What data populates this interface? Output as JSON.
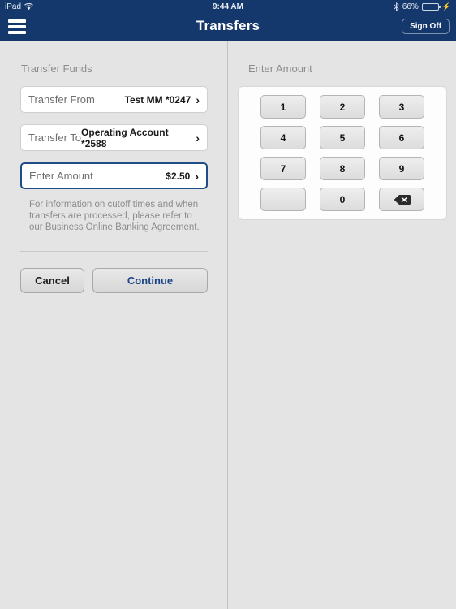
{
  "status_bar": {
    "device": "iPad",
    "wifi_icon": "wifi-icon",
    "time": "9:44 AM",
    "bluetooth_icon": "bluetooth-icon",
    "battery_percent": "66%",
    "battery_level": 66,
    "charging_icon": "lightning-bolt-icon"
  },
  "nav_bar": {
    "menu_icon": "hamburger-menu-icon",
    "title": "Transfers",
    "sign_off_label": "Sign Off"
  },
  "left_pane": {
    "section_title": "Transfer Funds",
    "rows": [
      {
        "label": "Transfer From",
        "value": "Test MM *0247",
        "chevron": "›",
        "focused": false
      },
      {
        "label": "Transfer To",
        "value": "Operating Account *2588",
        "chevron": "›",
        "focused": false
      },
      {
        "label": "Enter Amount",
        "value": "$2.50",
        "chevron": "›",
        "focused": true
      }
    ],
    "note": "For information on cutoff times and when transfers are processed, please refer to our Business Online Banking Agreement.",
    "cancel_label": "Cancel",
    "continue_label": "Continue"
  },
  "right_pane": {
    "section_title": "Enter Amount",
    "keys": [
      {
        "label": "1",
        "type": "digit"
      },
      {
        "label": "2",
        "type": "digit"
      },
      {
        "label": "3",
        "type": "digit"
      },
      {
        "label": "4",
        "type": "digit"
      },
      {
        "label": "5",
        "type": "digit"
      },
      {
        "label": "6",
        "type": "digit"
      },
      {
        "label": "7",
        "type": "digit"
      },
      {
        "label": "8",
        "type": "digit"
      },
      {
        "label": "9",
        "type": "digit"
      },
      {
        "label": "",
        "type": "blank"
      },
      {
        "label": "0",
        "type": "digit"
      },
      {
        "label": "",
        "type": "backspace"
      }
    ]
  },
  "colors": {
    "navy": "#14386b",
    "page_background": "#e4e4e4",
    "card_white": "#ffffff",
    "focus_border": "#1f4d87",
    "link_blue": "#1b4488",
    "battery_green": "#4cd545"
  }
}
